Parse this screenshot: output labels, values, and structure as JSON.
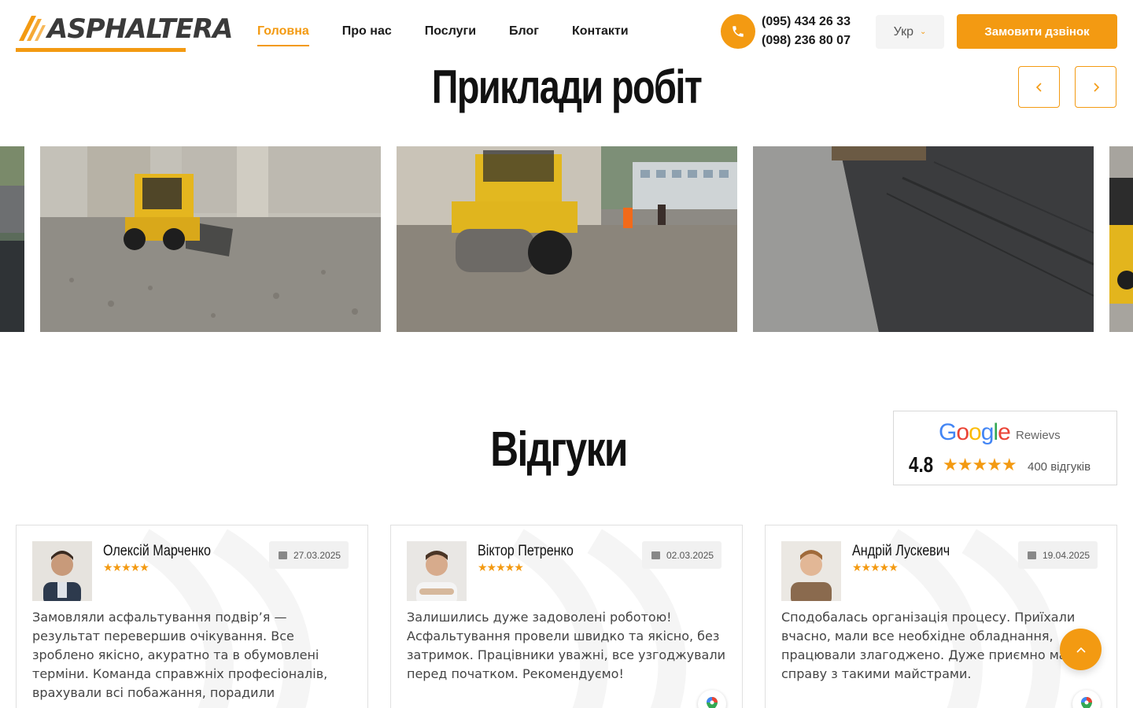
{
  "brand": {
    "name": "ASPHALTERA",
    "accent": "#f39a12"
  },
  "nav": {
    "items": [
      {
        "label": "Головна",
        "active": true
      },
      {
        "label": "Про нас",
        "active": false
      },
      {
        "label": "Послуги",
        "active": false
      },
      {
        "label": "Блог",
        "active": false
      },
      {
        "label": "Контакти",
        "active": false
      }
    ]
  },
  "contact": {
    "phone_icon": "phone-icon",
    "phone1": "(095) 434 26 33",
    "phone2": "(098) 236 80 07"
  },
  "language": {
    "selected": "Укр"
  },
  "cta": {
    "label": "Замовити дзвінок"
  },
  "works": {
    "title": "Приклади робіт",
    "prev_icon": "chevron-left-icon",
    "next_icon": "chevron-right-icon",
    "slides": [
      {
        "alt": "skid-steer-loader-on-gravel"
      },
      {
        "alt": "bomag-road-roller-with-workers"
      },
      {
        "alt": "fresh-asphalt-surface"
      }
    ]
  },
  "reviews": {
    "title": "Відгуки",
    "google": {
      "logo": "Google",
      "label": "Rewievs",
      "rating": "4.8",
      "stars": "★★★★★",
      "count": "400 відгуків"
    },
    "items": [
      {
        "name": "Олексій Марченко",
        "stars": "★★★★★",
        "date": "27.03.2025",
        "text": "Замовляли асфальтування подвір’я — результат перевершив очікування. Все зроблено якісно, акуратно та в обумовлені терміни. Команда справжніх професіоналів, врахували всі побажання, порадили"
      },
      {
        "name": "Віктор Петренко",
        "stars": "★★★★★",
        "date": "02.03.2025",
        "text": "Залишились дуже задоволені роботою! Асфальтування провели швидко та якісно, без затримок. Працівники уважні, все узгоджували перед початком. Рекомендуємо!"
      },
      {
        "name": "Андрій Лускевич",
        "stars": "★★★★★",
        "date": "19.04.2025",
        "text": "Сподобалась організація процесу. Приїхали вчасно, мали все необхідне обладнання, працювали злагоджено. Дуже приємно мати справу з такими майстрами."
      }
    ]
  },
  "scroll_top_icon": "chevron-up-icon"
}
